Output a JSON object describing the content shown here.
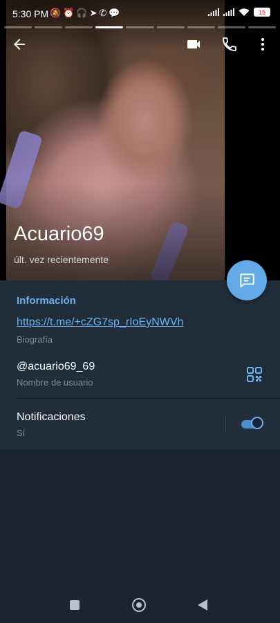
{
  "status_bar": {
    "time": "5:30 PM",
    "notification_icons": [
      "muted-bell-icon",
      "alarm-icon",
      "headphones-icon",
      "telegram-icon",
      "whatsapp-icon",
      "chat-icon"
    ],
    "right_icons": [
      "signal-icon",
      "signal-icon",
      "wifi-icon"
    ],
    "battery": "15"
  },
  "story_progress": {
    "segments": 9,
    "active_index": 3
  },
  "top_bar": {
    "back_icon": "arrow-back-icon",
    "actions": [
      "video-call-icon",
      "phone-icon",
      "more-vertical-icon"
    ]
  },
  "profile": {
    "name": "Acuario69",
    "last_seen": "últ. vez recientemente"
  },
  "fab": {
    "icon": "message-icon"
  },
  "info": {
    "title": "Información",
    "bio_link": "https://t.me/+cZG7sp_rIoEyNWVh",
    "bio_label": "Biografía",
    "username": "@acuario69_69",
    "username_label": "Nombre de usuario",
    "notifications": "Notificaciones",
    "notifications_value": "Sí",
    "notifications_enabled": true
  },
  "colors": {
    "accent": "#6ab2f2",
    "panel": "#222d3a",
    "background": "#1c242f",
    "fab": "#62a9e6"
  },
  "nav_bar": [
    "recents-square-icon",
    "home-circle-icon",
    "back-triangle-icon"
  ]
}
